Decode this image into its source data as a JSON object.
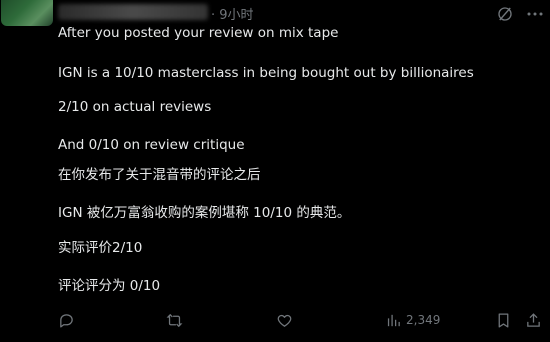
{
  "header": {
    "timestamp": "· 9小时",
    "grok_icon": "grok-icon",
    "more_icon": "more-icon"
  },
  "body": {
    "lines": [
      "After you posted your review on mix tape",
      "IGN is a 10/10 masterclass in being bought out by billionaires",
      "2/10 on actual reviews",
      "And 0/10 on review critique",
      "在你发布了关于混音带的评论之后",
      "IGN 被亿万富翁收购的案例堪称 10/10 的典范。",
      "实际评价2/10",
      "评论评分为 0/10"
    ]
  },
  "actions": {
    "reply_icon": "reply-icon",
    "retweet_icon": "retweet-icon",
    "like_icon": "heart-icon",
    "views_icon": "views-icon",
    "views_count": "2,349",
    "bookmark_icon": "bookmark-icon",
    "share_icon": "share-icon"
  },
  "colors": {
    "background": "#000000",
    "text": "#e7e9ea",
    "secondary": "#71767b"
  }
}
